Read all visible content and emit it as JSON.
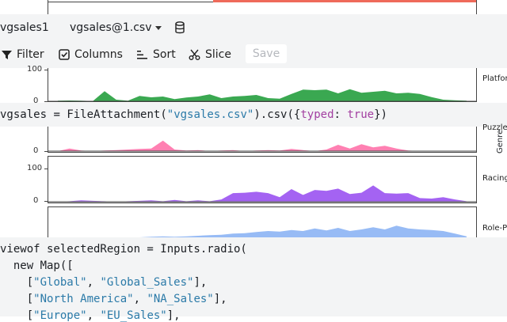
{
  "cell_header": {
    "name": "vgsales1",
    "file": "vgsales@1.csv",
    "database_icon": "database-icon",
    "dropdown_icon": "caret-down-icon"
  },
  "toolbar": {
    "filter": "Filter",
    "columns": "Columns",
    "sort": "Sort",
    "slice": "Slice",
    "save": "Save"
  },
  "code_line1": {
    "var": "vgsales",
    "eq": " = ",
    "fn": "FileAttachment",
    "open": "(",
    "str": "\"vgsales.csv\"",
    "rest1": ").csv({",
    "key": "typed",
    "colon": ": ",
    "val": "true",
    "close": "})"
  },
  "code_block": {
    "l1_a": "viewof selectedRegion = Inputs.radio(",
    "l2_a": "  new Map([",
    "l3_a": "    [",
    "l3_s1": "\"Global\"",
    "l3_b": ", ",
    "l3_s2": "\"Global_Sales\"",
    "l3_c": "],",
    "l4_a": "    [",
    "l4_s1": "\"North America\"",
    "l4_b": ", ",
    "l4_s2": "\"NA_Sales\"",
    "l4_c": "],",
    "l5_a": "    [",
    "l5_s1": "\"Europe\"",
    "l5_b": ", ",
    "l5_s2": "\"EU_Sales\"",
    "l5_c": "],"
  },
  "facet_axis_label": "Genre",
  "chart_data": {
    "type": "area",
    "facets": [
      {
        "name": "Platfor",
        "color": "#3aa851",
        "yticks": [
          "100",
          "0"
        ],
        "ymax": 120,
        "values": [
          2,
          3,
          2,
          1,
          38,
          6,
          2,
          20,
          15,
          18,
          8,
          14,
          18,
          26,
          12,
          18,
          20,
          24,
          12,
          10,
          28,
          44,
          42,
          44,
          30,
          46,
          32,
          36,
          40,
          30,
          32,
          28,
          16,
          6,
          4,
          2
        ]
      },
      {
        "name": "Puzzle",
        "color": "#ff80b2",
        "yticks": [
          "0"
        ],
        "ymax": 120,
        "values": [
          0,
          10,
          2,
          0,
          2,
          4,
          6,
          8,
          10,
          40,
          6,
          2,
          4,
          0,
          2,
          4,
          0,
          2,
          4,
          2,
          8,
          4,
          0,
          6,
          24,
          10,
          26,
          14,
          20,
          10,
          2,
          0,
          0,
          0,
          0,
          0
        ]
      },
      {
        "name": "Racing",
        "color": "#a463f2",
        "yticks": [
          "100",
          "0"
        ],
        "ymax": 140,
        "values": [
          0,
          2,
          6,
          4,
          2,
          0,
          2,
          4,
          6,
          2,
          8,
          2,
          6,
          2,
          10,
          38,
          40,
          44,
          38,
          20,
          56,
          30,
          52,
          48,
          58,
          34,
          40,
          72,
          38,
          36,
          38,
          16,
          14,
          20,
          10,
          2
        ]
      },
      {
        "name": "Role-P",
        "color": "#97bbf5",
        "yticks": [],
        "ymax": 120,
        "values": [
          0,
          0,
          2,
          2,
          4,
          6,
          6,
          6,
          8,
          10,
          8,
          10,
          12,
          14,
          16,
          20,
          22,
          26,
          30,
          28,
          34,
          30,
          40,
          32,
          42,
          30,
          36,
          44,
          36,
          50,
          40,
          36,
          34,
          30,
          20,
          10
        ]
      }
    ]
  }
}
